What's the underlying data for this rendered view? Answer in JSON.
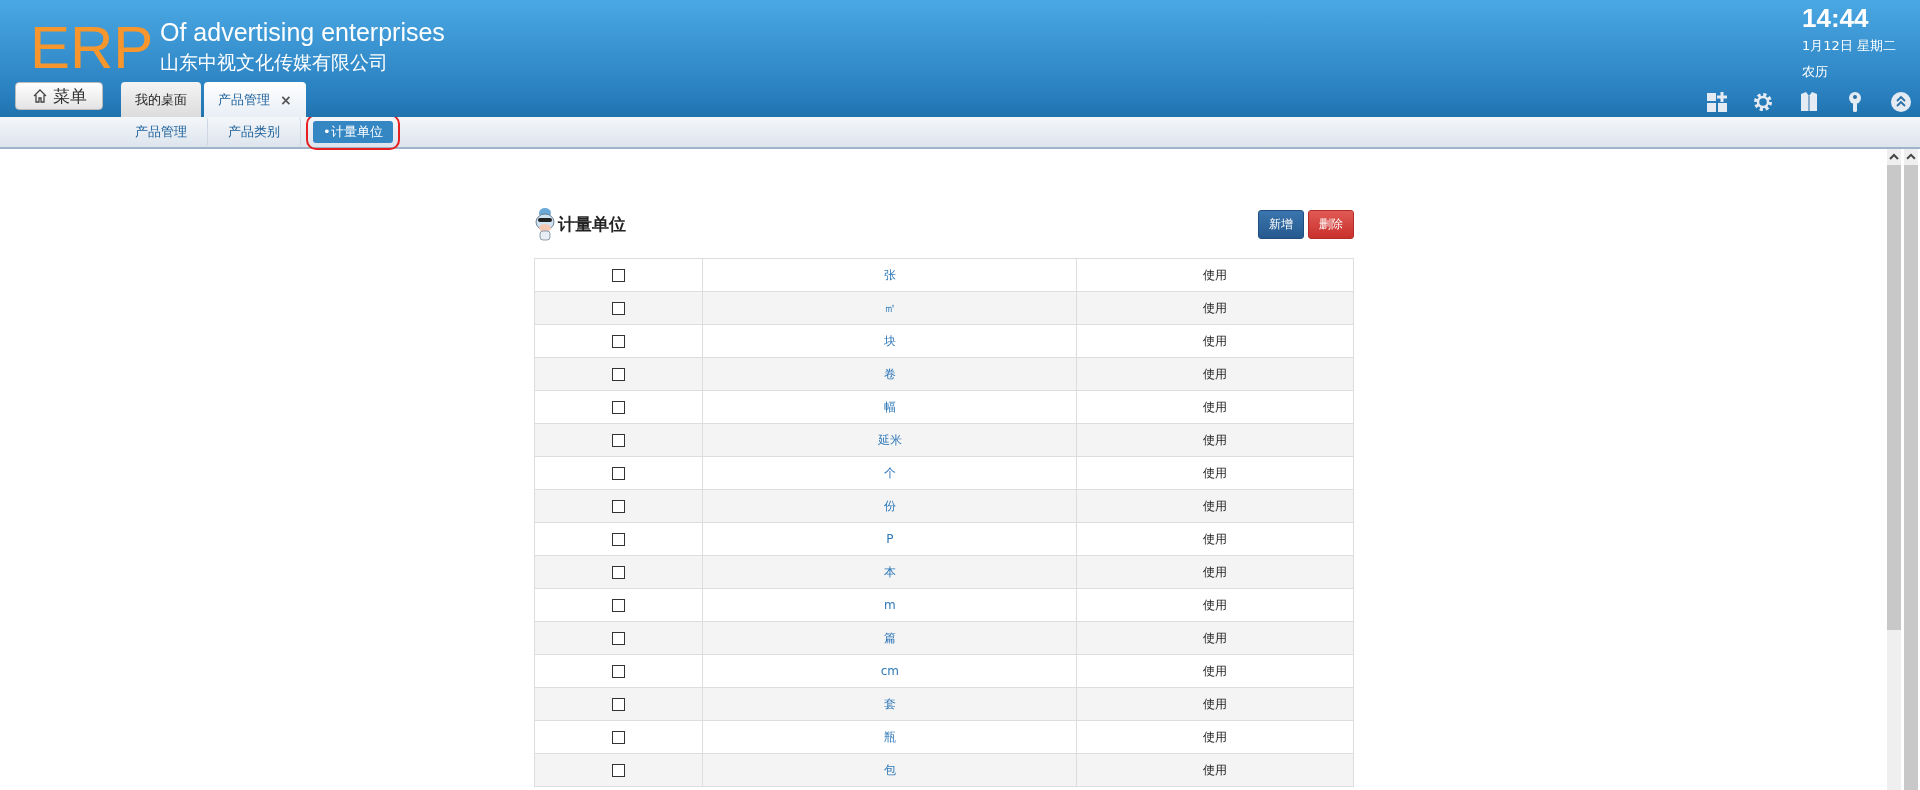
{
  "header": {
    "logo": "ERP",
    "title": "Of advertising enterprises",
    "company": "山东中视文化传媒有限公司",
    "menu_button": "菜单",
    "clock": {
      "time": "14:44",
      "date": "1月12日 星期二",
      "lunar": "农历"
    }
  },
  "tabs": [
    {
      "label": "我的桌面",
      "selected": false
    },
    {
      "label": "产品管理",
      "selected": true,
      "close": "×"
    }
  ],
  "subnav": [
    {
      "label": "产品管理",
      "selected": false,
      "highlighted": false
    },
    {
      "label": "产品类别",
      "selected": false,
      "highlighted": false
    },
    {
      "label": "•计量单位",
      "selected": true,
      "highlighted": true
    }
  ],
  "panel": {
    "title": "计量单位",
    "buttons": [
      {
        "label": "新增",
        "kind": "primary"
      },
      {
        "label": "删除",
        "kind": "danger"
      }
    ]
  },
  "units": [
    {
      "checked": false,
      "name": "张",
      "status": "使用"
    },
    {
      "checked": false,
      "name": "㎡",
      "status": "使用"
    },
    {
      "checked": false,
      "name": "块",
      "status": "使用"
    },
    {
      "checked": false,
      "name": "卷",
      "status": "使用"
    },
    {
      "checked": false,
      "name": "幅",
      "status": "使用"
    },
    {
      "checked": false,
      "name": "延米",
      "status": "使用"
    },
    {
      "checked": false,
      "name": "个",
      "status": "使用"
    },
    {
      "checked": false,
      "name": "份",
      "status": "使用"
    },
    {
      "checked": false,
      "name": "P",
      "status": "使用"
    },
    {
      "checked": false,
      "name": "本",
      "status": "使用"
    },
    {
      "checked": false,
      "name": "m",
      "status": "使用"
    },
    {
      "checked": false,
      "name": "篇",
      "status": "使用"
    },
    {
      "checked": false,
      "name": "cm",
      "status": "使用"
    },
    {
      "checked": false,
      "name": "套",
      "status": "使用"
    },
    {
      "checked": false,
      "name": "瓶",
      "status": "使用"
    },
    {
      "checked": false,
      "name": "包",
      "status": "使用"
    }
  ]
}
